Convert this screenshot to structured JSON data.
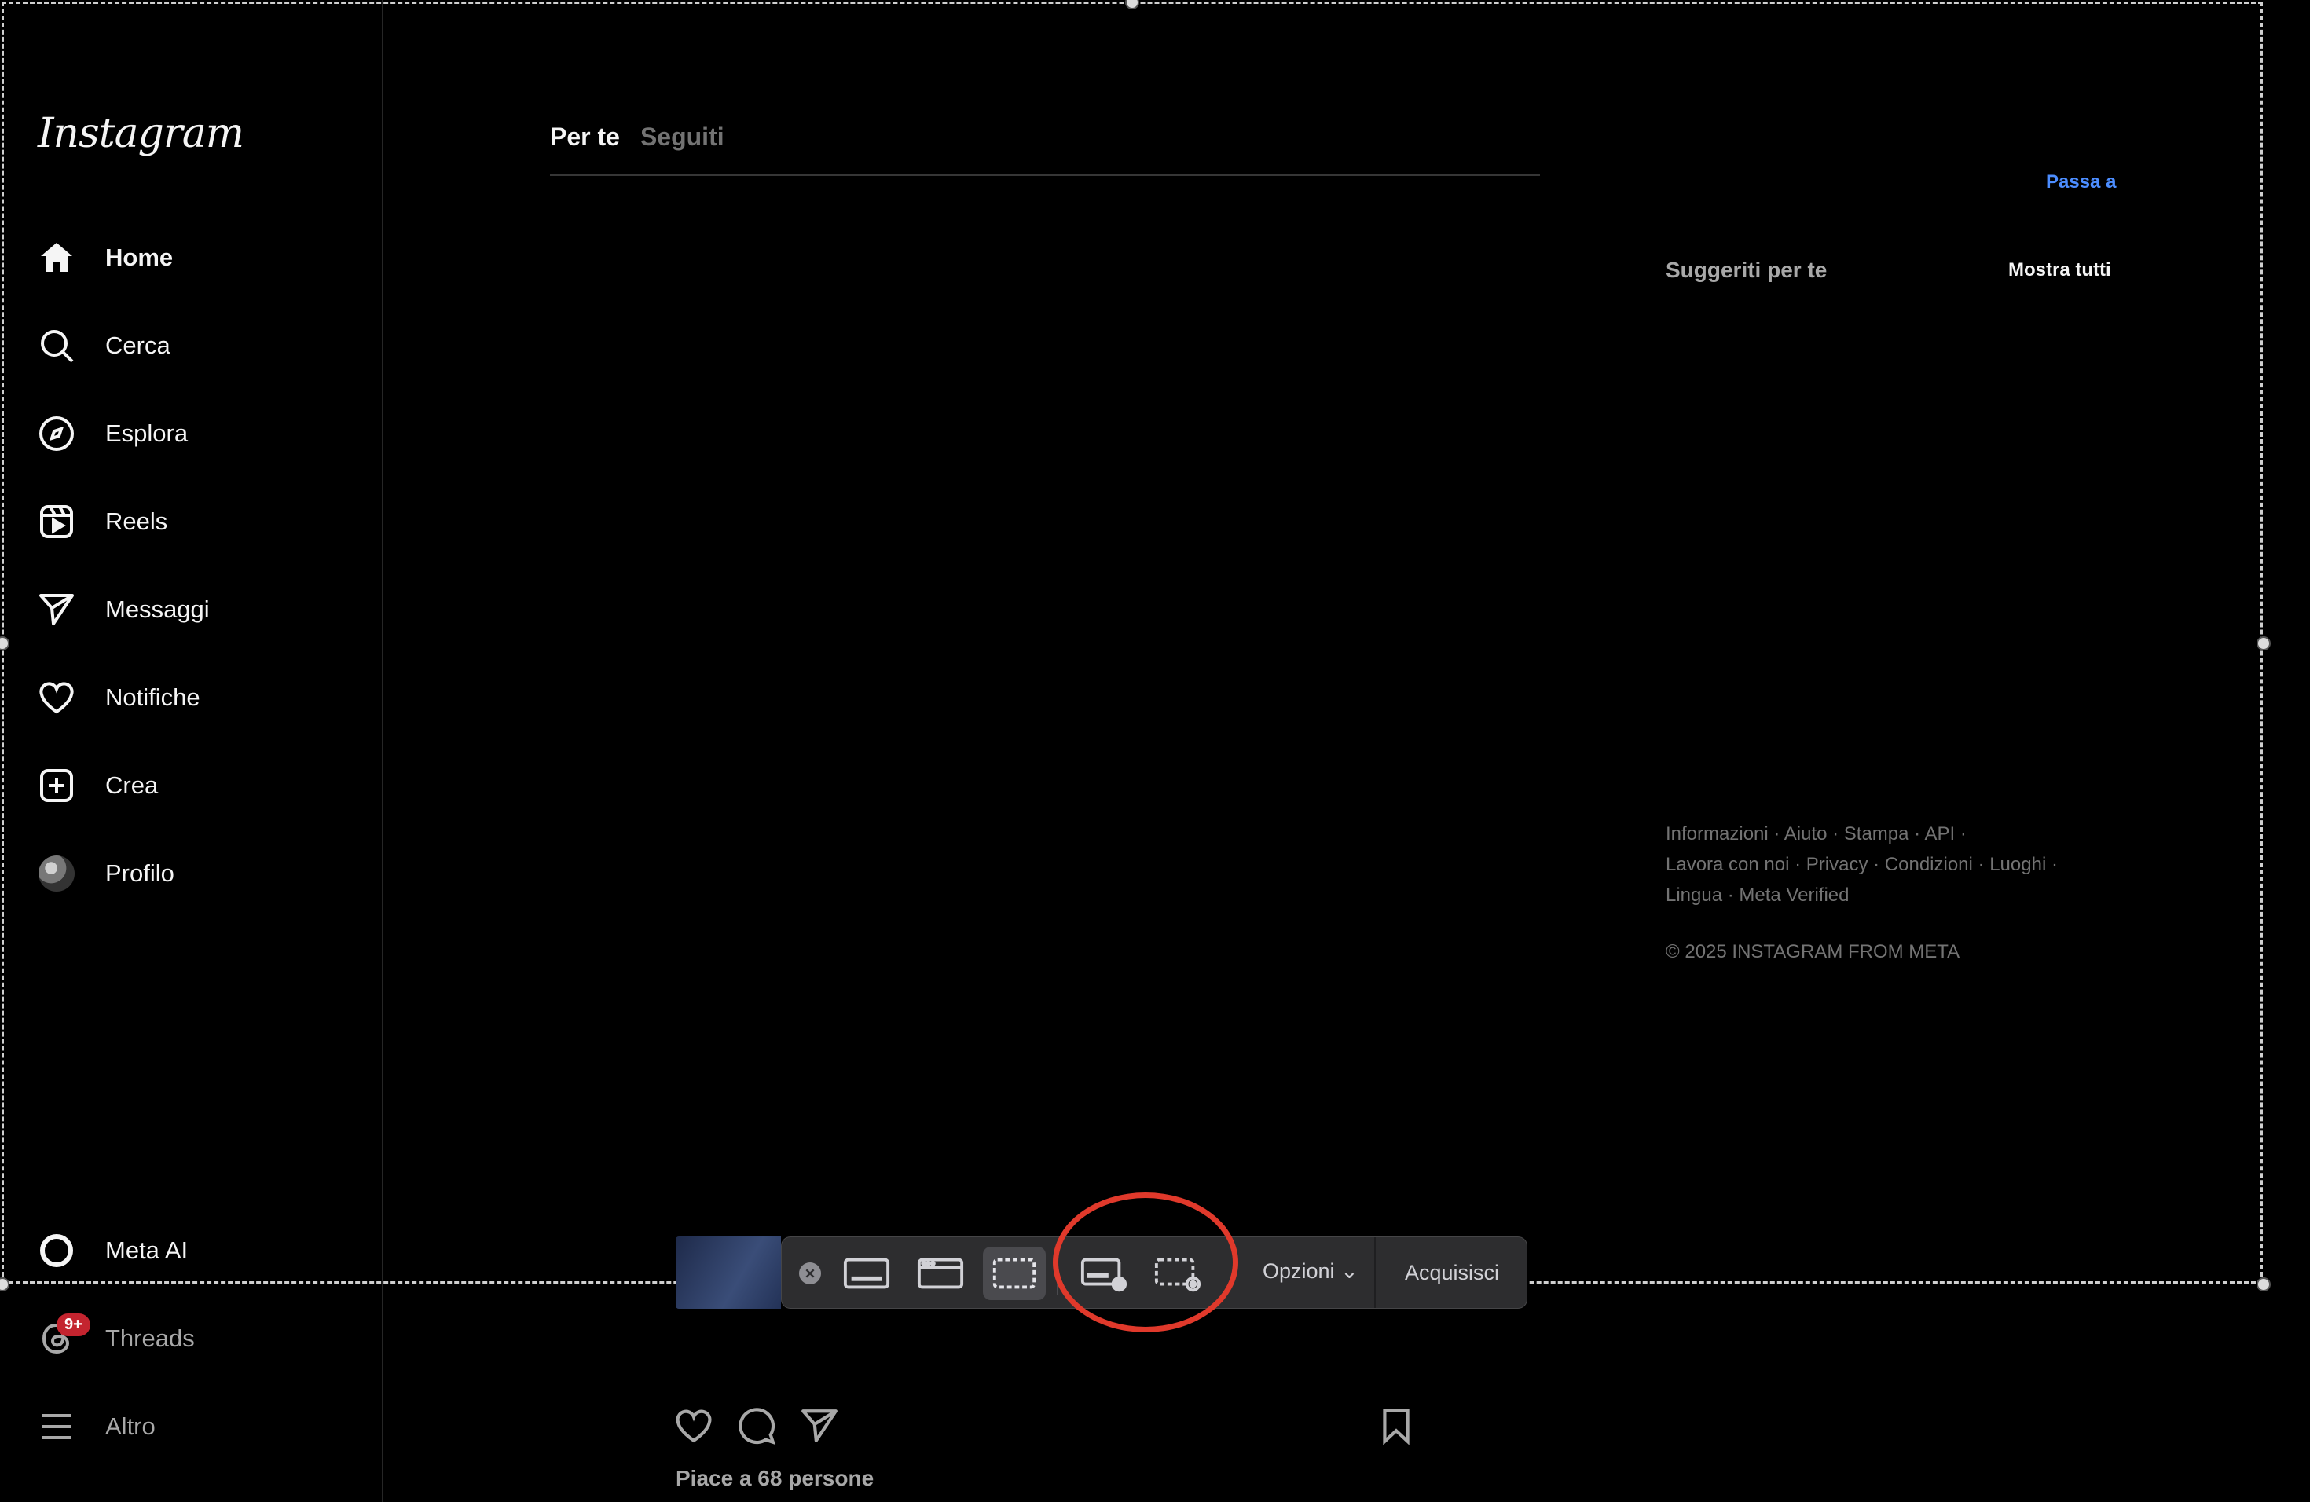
{
  "sidebar": {
    "logo": "Instagram",
    "items": [
      {
        "label": "Home"
      },
      {
        "label": "Cerca"
      },
      {
        "label": "Esplora"
      },
      {
        "label": "Reels"
      },
      {
        "label": "Messaggi"
      },
      {
        "label": "Notifiche"
      },
      {
        "label": "Crea"
      },
      {
        "label": "Profilo"
      }
    ],
    "bottom": [
      {
        "label": "Meta AI"
      },
      {
        "label": "Threads",
        "badge": "9+"
      },
      {
        "label": "Altro"
      }
    ]
  },
  "feed": {
    "tabs": [
      {
        "label": "Per te"
      },
      {
        "label": "Seguiti"
      }
    ],
    "likes_text": "Piace a 68 persone"
  },
  "right": {
    "switch_label": "Passa a",
    "suggestions_title": "Suggeriti per te",
    "show_all": "Mostra tutti",
    "footer": {
      "l1": [
        "Informazioni",
        "Aiuto",
        "Stampa",
        "API"
      ],
      "l2": [
        "Lavora con noi",
        "Privacy",
        "Condizioni",
        "Luoghi"
      ],
      "l3": [
        "Lingua",
        "Meta Verified"
      ],
      "sep": " · ",
      "copyright": "© 2025 INSTAGRAM FROM META"
    }
  },
  "capture_toolbar": {
    "options_label": "Opzioni",
    "capture_label": "Acquisisci"
  },
  "colors": {
    "background": "#000000",
    "link": "#4c8dff",
    "badge": "#c4242f",
    "highlight": "#e0392b"
  }
}
